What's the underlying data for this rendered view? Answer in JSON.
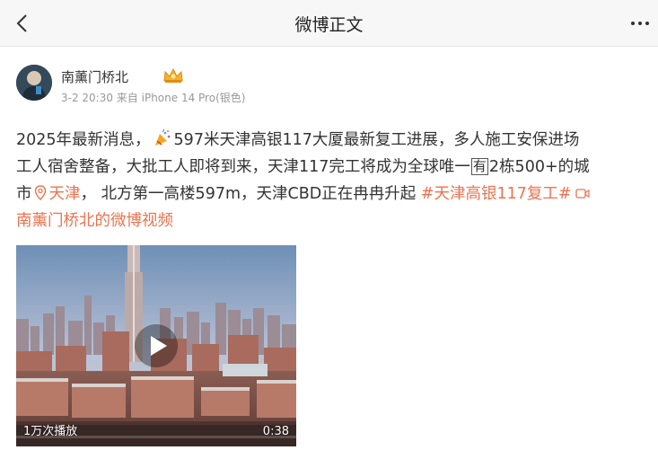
{
  "navbar": {
    "title": "微博正文",
    "back_icon": "chevron-left-icon",
    "more_icon": "more-dots-icon"
  },
  "author": {
    "name": "南薰门桥北",
    "badge_icon": "crown-icon",
    "meta": "3-2 20:30 来自 iPhone 14 Pro(银色)"
  },
  "post": {
    "line1_a": "2025年最新消息，",
    "line1_b": "597米天津高银117大厦最新复工进展，多人施工安保进场",
    "line2_a": "工人宿舍整备，大批工人即将到来，天津117完工将成为全球唯一",
    "line2_box": "有",
    "line2_b": "2栋500+的城",
    "line3_a": "市",
    "location": "天津",
    "line3_b": "， 北方第一高楼597m，天津CBD正在冉冉升起",
    "hashtag": "#天津高银117复工#",
    "video_link": "南薰门桥北的微博视频",
    "link_color": "#eb7350"
  },
  "video": {
    "views": "1万次播放",
    "duration": "0:38"
  }
}
